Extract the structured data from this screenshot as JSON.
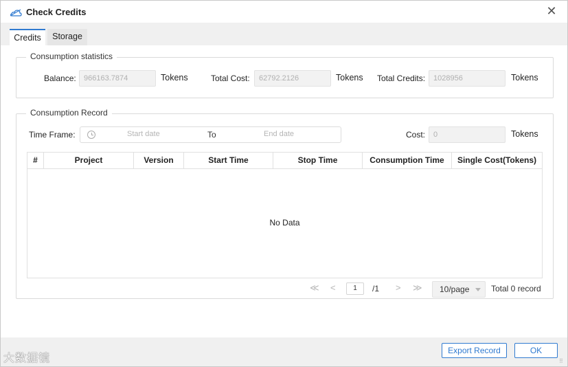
{
  "window": {
    "title": "Check Credits",
    "close_symbol": "✕"
  },
  "tabs": [
    {
      "label": "Credits",
      "active": true
    },
    {
      "label": "Storage",
      "active": false
    }
  ],
  "consumption_statistics": {
    "legend": "Consumption statistics",
    "balance_label": "Balance:",
    "balance_value": "966163.7874",
    "balance_unit": "Tokens",
    "total_cost_label": "Total Cost:",
    "total_cost_value": "62792.2126",
    "total_cost_unit": "Tokens",
    "total_credits_label": "Total Credits:",
    "total_credits_value": "1028956",
    "total_credits_unit": "Tokens"
  },
  "consumption_record": {
    "legend": "Consumption Record",
    "time_frame_label": "Time Frame:",
    "start_placeholder": "Start date",
    "to_label": "To",
    "end_placeholder": "End date",
    "cost_label": "Cost:",
    "cost_value": "0",
    "cost_unit": "Tokens"
  },
  "table": {
    "columns": [
      "#",
      "Project",
      "Version",
      "Start Time",
      "Stop Time",
      "Consumption Time",
      "Single Cost(Tokens)"
    ],
    "empty_text": "No Data"
  },
  "pagination": {
    "first": "≪",
    "prev": "<",
    "current_page": "1",
    "total_pages": "/1",
    "next": ">",
    "last": "≫",
    "page_size": "10/page",
    "total_records": "Total 0 record"
  },
  "footer": {
    "export_label": "Export Record",
    "ok_label": "OK",
    "watermark": "大数据镜"
  },
  "colors": {
    "accent": "#2f7ad0",
    "field_bg": "#f2f2f2",
    "chrome_bg": "#f0f0f0"
  },
  "icons": {
    "title": "cloud-icon",
    "close": "close-icon",
    "date": "clock-icon"
  }
}
